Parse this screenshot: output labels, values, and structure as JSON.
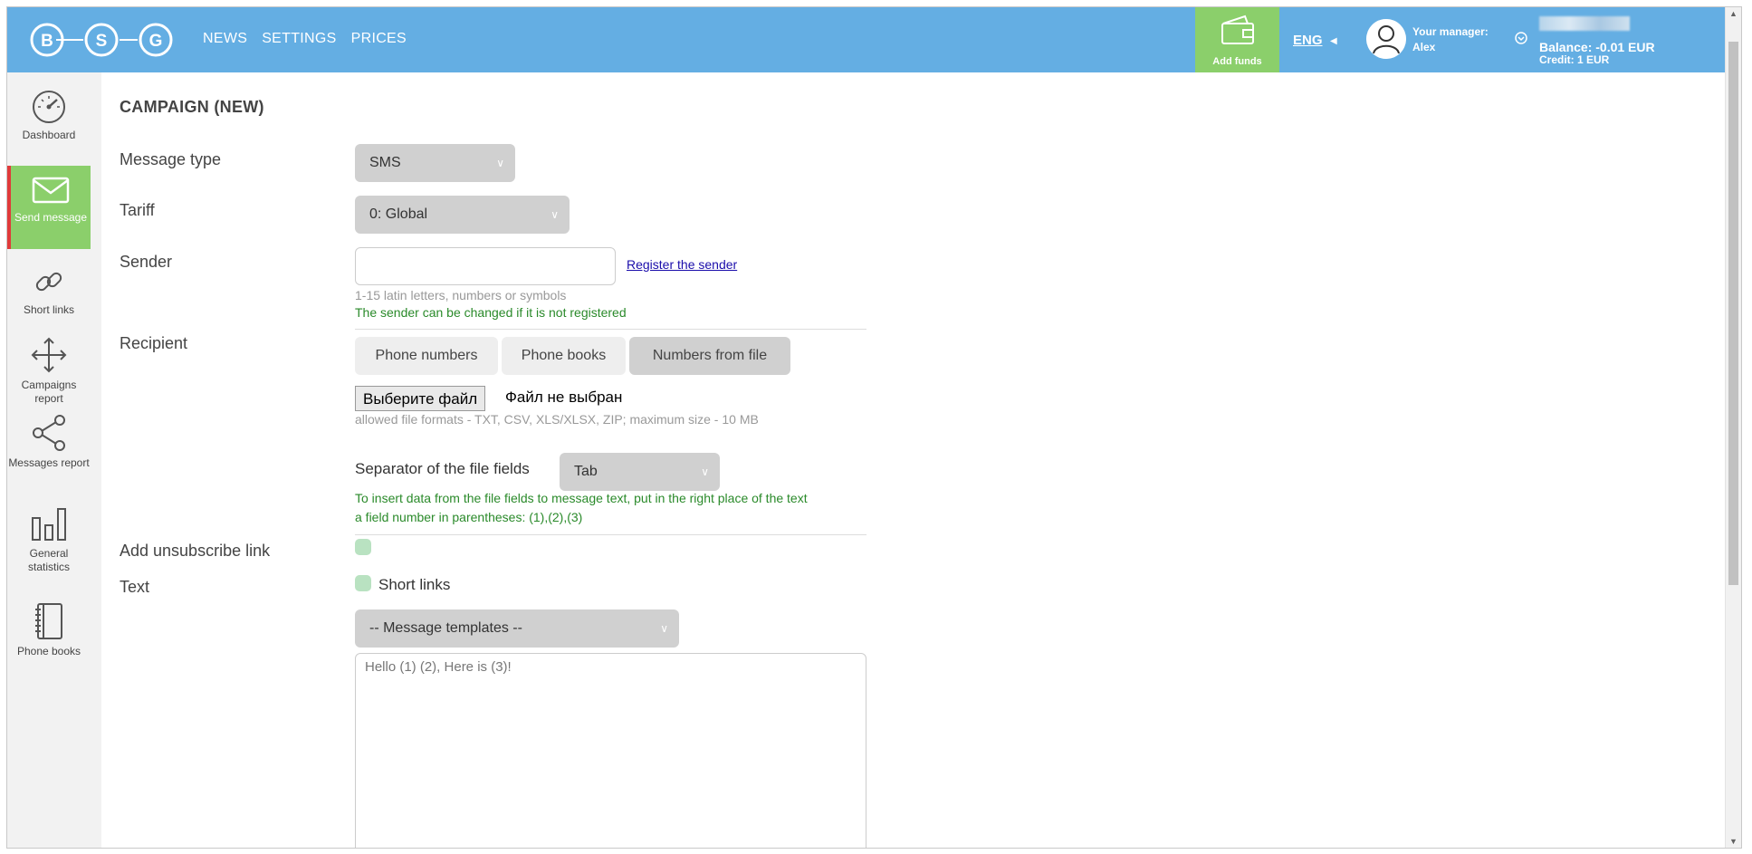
{
  "header": {
    "logo_letters": [
      "B",
      "S",
      "G"
    ],
    "nav": [
      "NEWS",
      "SETTINGS",
      "PRICES"
    ],
    "add_funds": "Add funds",
    "language": "ENG",
    "manager_label": "Your manager:",
    "manager_name": "Alex",
    "balance": "Balance: -0.01 EUR",
    "credit": "Credit: 1 EUR",
    "brand_color": "#64aee3",
    "accent_color": "#8bcf6b"
  },
  "sidebar": {
    "items": [
      {
        "label": "Dashboard",
        "icon": "speedometer-icon"
      },
      {
        "label": "Send message",
        "icon": "envelope-icon",
        "active": true
      },
      {
        "label": "Short links",
        "icon": "link-icon"
      },
      {
        "label": "Campaigns report",
        "icon": "move-arrows-icon"
      },
      {
        "label": "Messages report",
        "icon": "share-icon"
      },
      {
        "label": "General statistics",
        "icon": "bar-chart-icon"
      },
      {
        "label": "Phone books",
        "icon": "notebook-icon"
      }
    ]
  },
  "form": {
    "title": "CAMPAIGN (NEW)",
    "message_type": {
      "label": "Message type",
      "value": "SMS"
    },
    "tariff": {
      "label": "Tariff",
      "value": "0: Global"
    },
    "sender": {
      "label": "Sender",
      "value": "",
      "register_link": "Register the sender",
      "hint": "1-15 latin letters, numbers or symbols",
      "note": "The sender can be changed if it is not registered"
    },
    "recipient": {
      "label": "Recipient",
      "tabs": [
        "Phone numbers",
        "Phone books",
        "Numbers from file"
      ],
      "active_tab": "Numbers from file",
      "file_button": "Выберите файл",
      "file_status": "Файл не выбран",
      "formats_hint": "allowed file formats - TXT, CSV, XLS/XLSX, ZIP; maximum size - 10 MB",
      "separator_label": "Separator of the file fields",
      "separator_value": "Tab",
      "insert_note_line1": "To insert data from the file fields to message text, put in the right place of the text",
      "insert_note_line2": "a field number in parentheses: (1),(2),(3)"
    },
    "unsubscribe": {
      "label": "Add unsubscribe link"
    },
    "text": {
      "label": "Text",
      "short_links_label": "Short links",
      "templates_placeholder": "-- Message templates --",
      "message_value": "Hello (1) (2), Here is (3)!"
    }
  }
}
